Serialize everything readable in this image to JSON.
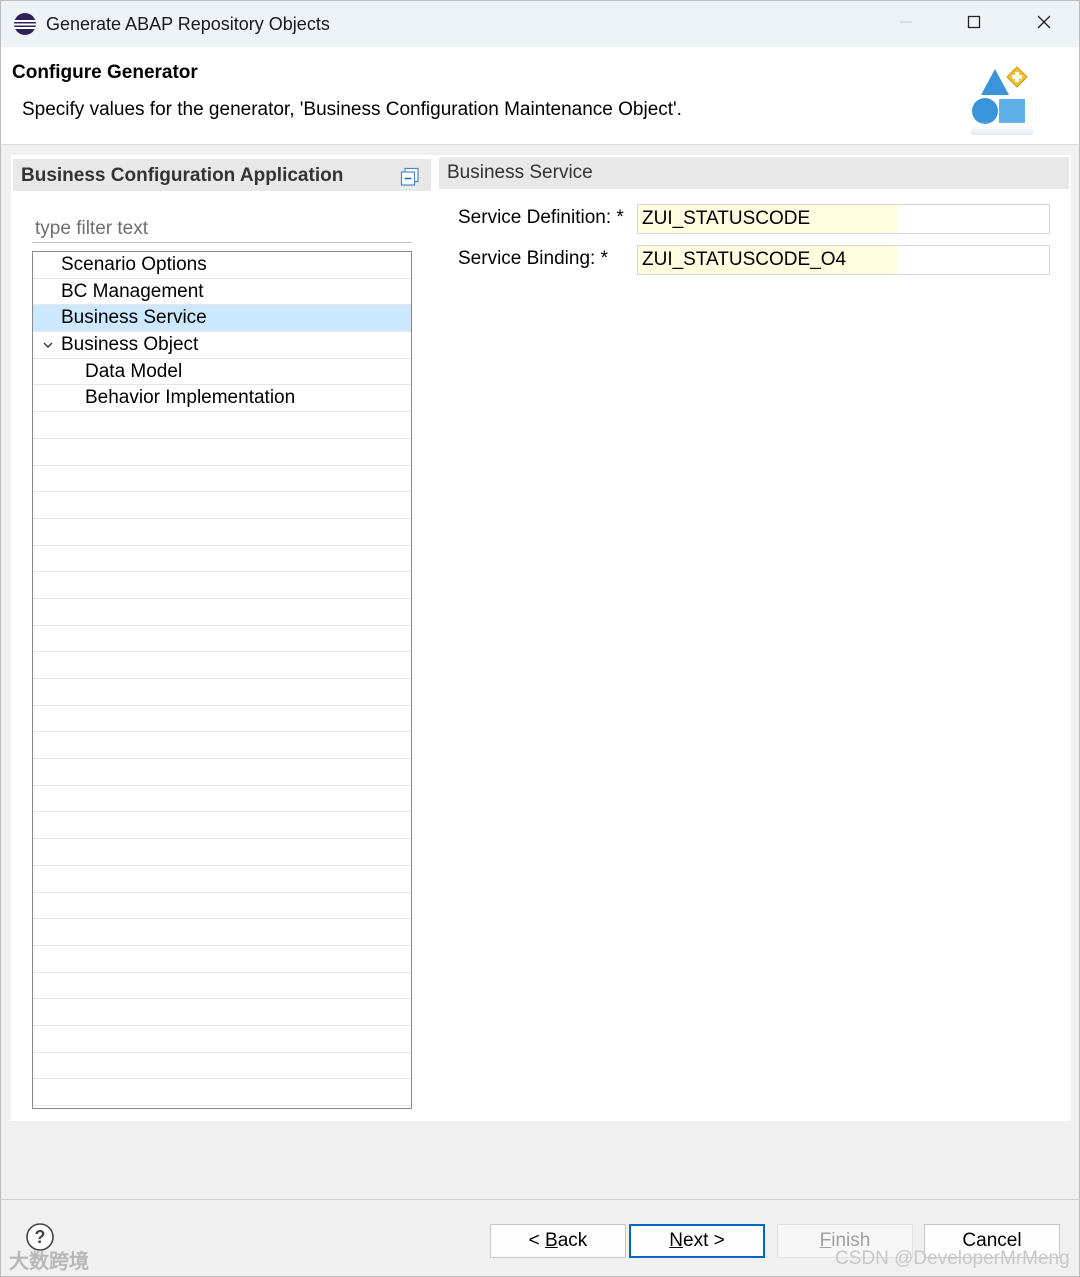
{
  "window": {
    "title": "Generate ABAP Repository Objects"
  },
  "header": {
    "title": "Configure Generator",
    "description": "Specify values for the generator, 'Business Configuration Maintenance Object'."
  },
  "left_panel": {
    "title": "Business Configuration Application",
    "filter_placeholder": "type filter text",
    "tree_items": [
      {
        "label": "Scenario Options",
        "level": 0,
        "selected": false,
        "expandable": false
      },
      {
        "label": "BC Management",
        "level": 0,
        "selected": false,
        "expandable": false
      },
      {
        "label": "Business Service",
        "level": 0,
        "selected": true,
        "expandable": false
      },
      {
        "label": "Business Object",
        "level": 0,
        "selected": false,
        "expandable": true,
        "expanded": true
      },
      {
        "label": "Data Model",
        "level": 1,
        "selected": false,
        "expandable": false
      },
      {
        "label": "Behavior Implementation",
        "level": 1,
        "selected": false,
        "expandable": false
      }
    ]
  },
  "right_panel": {
    "title": "Business Service",
    "fields": [
      {
        "label": "Service Definition: *",
        "value": "ZUI_STATUSCODE"
      },
      {
        "label": "Service Binding: *",
        "value": "ZUI_STATUSCODE_O4"
      }
    ]
  },
  "buttons": {
    "back": {
      "prefix": "< ",
      "mnemonic": "B",
      "rest": "ack"
    },
    "next": {
      "mnemonic": "N",
      "rest": "ext >"
    },
    "finish": {
      "mnemonic": "F",
      "rest": "inish"
    },
    "cancel": {
      "label": "Cancel"
    }
  },
  "watermarks": {
    "left": "大数跨境",
    "right": "CSDN @DeveloperMrMeng"
  },
  "icons": {
    "app": "eclipse-icon",
    "header": "generator-shapes-icon",
    "collapse": "collapse-all-icon",
    "help": "help-icon"
  }
}
